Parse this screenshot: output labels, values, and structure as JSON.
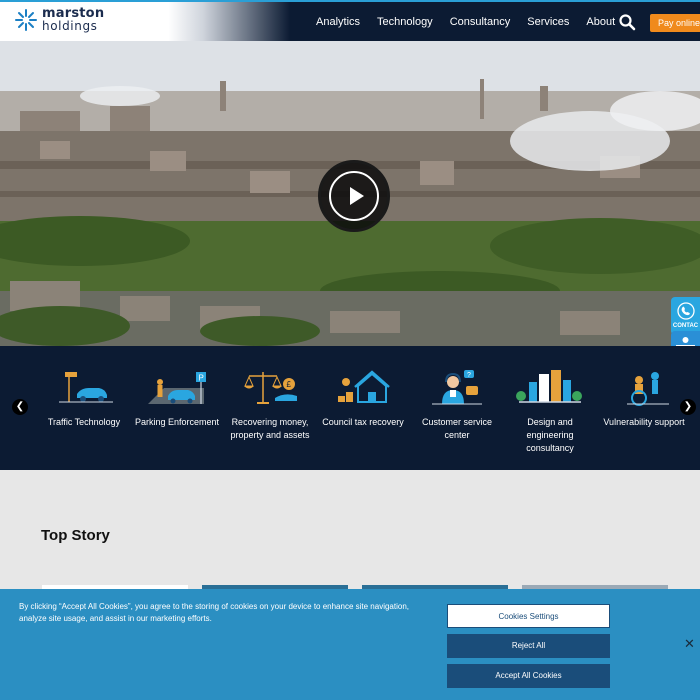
{
  "brand": {
    "name_line1": "marston",
    "name_line2": "holdings"
  },
  "nav": {
    "items": [
      "Analytics",
      "Technology",
      "Consultancy",
      "Services",
      "About"
    ],
    "pay_label": "Pay online"
  },
  "hero": {
    "contact_label": "CONTAC"
  },
  "services": [
    {
      "label": "Traffic Technology",
      "icon": "traffic-camera-icon"
    },
    {
      "label": "Parking Enforcement",
      "icon": "parking-icon"
    },
    {
      "label": "Recovering money, property and assets",
      "icon": "scales-icon"
    },
    {
      "label": "Council tax recovery",
      "icon": "house-coins-icon"
    },
    {
      "label": "Customer service center",
      "icon": "headset-agent-icon"
    },
    {
      "label": "Design and engineering consultancy",
      "icon": "city-buildings-icon"
    },
    {
      "label": "Vulnerability support",
      "icon": "wheelchair-support-icon"
    }
  ],
  "top_story": {
    "heading": "Top Story"
  },
  "cookie": {
    "text": "By clicking “Accept All Cookies”, you agree to the storing of cookies on your device to enhance site navigation, analyze site usage, and assist in our marketing efforts.",
    "settings_label": "Cookies Settings",
    "reject_label": "Reject All",
    "accept_label": "Accept All Cookies",
    "close_label": "✕"
  },
  "colors": {
    "navy": "#0c1b33",
    "accent_blue": "#2aa6e0",
    "orange": "#f08a1c",
    "cookie_bg": "#2b8fc2",
    "cookie_button": "#1a4d7a"
  }
}
